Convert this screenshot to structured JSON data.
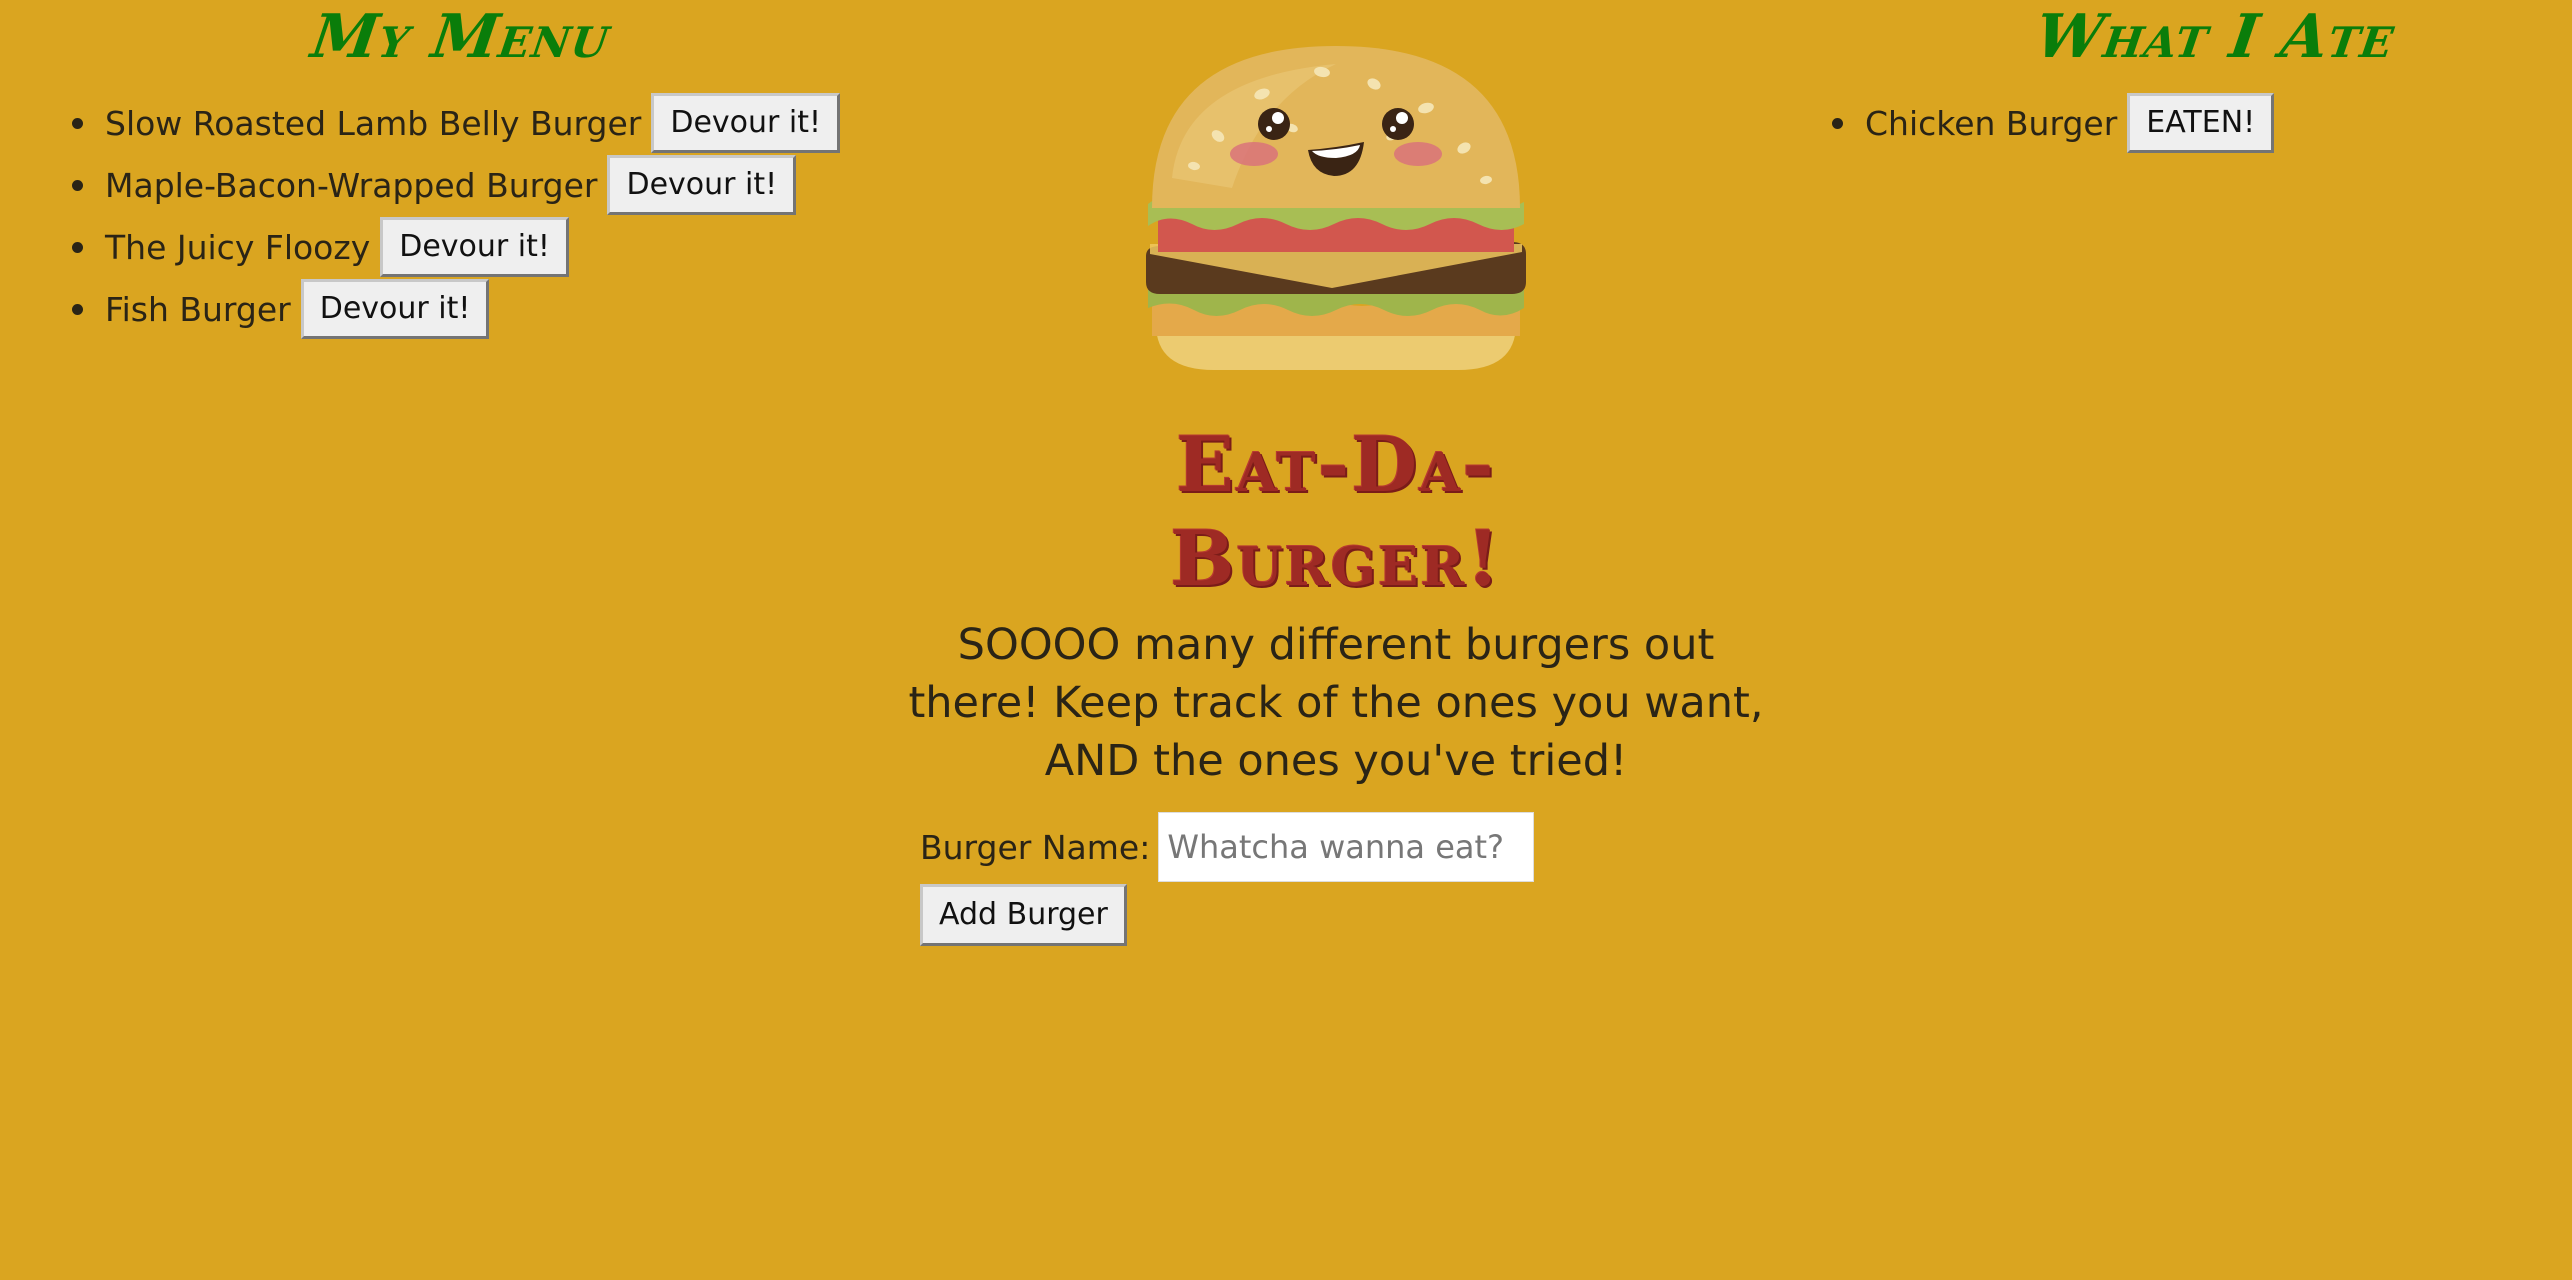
{
  "menu": {
    "title": "My Menu",
    "items": [
      {
        "name": "Slow Roasted Lamb Belly Burger",
        "button": "Devour it!"
      },
      {
        "name": "Maple-Bacon-Wrapped Burger",
        "button": "Devour it!"
      },
      {
        "name": "The Juicy Floozy",
        "button": "Devour it!"
      },
      {
        "name": "Fish Burger",
        "button": "Devour it!"
      }
    ]
  },
  "eaten": {
    "title": "What I Ate",
    "items": [
      {
        "name": "Chicken Burger",
        "button": "EATEN!"
      }
    ]
  },
  "hero": {
    "image": "smiling-burger-illustration"
  },
  "site": {
    "title": "Eat-Da-Burger!",
    "tagline": "SOOOO many different burgers out there! Keep track of the ones you want, AND the ones you've tried!"
  },
  "form": {
    "label": "Burger Name:",
    "placeholder": "Whatcha wanna eat?",
    "value": "",
    "submit_label": "Add Burger"
  },
  "colors": {
    "background": "#DAA520",
    "column_title": "#0a7d0a",
    "site_title": "#9e2a24"
  }
}
